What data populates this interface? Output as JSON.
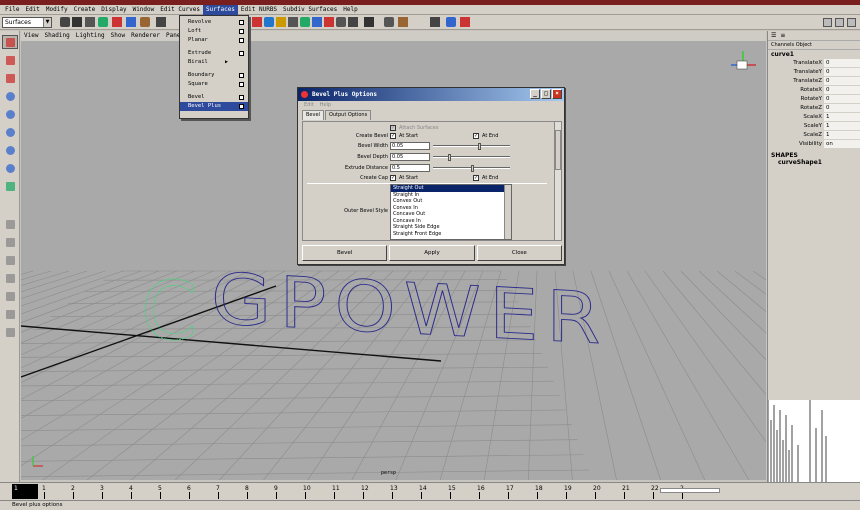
{
  "menubar": {
    "items": [
      "File",
      "Edit",
      "Modify",
      "Create",
      "Display",
      "Window",
      "Edit Curves",
      "Surfaces",
      "Edit NURBS",
      "Subdiv Surfaces",
      "Help"
    ],
    "active_index": 7
  },
  "toolbar": {
    "menuset": "Surfaces"
  },
  "panel_menu": [
    "View",
    "Shading",
    "Lighting",
    "Show",
    "Renderer",
    "Panels"
  ],
  "surfaces_menu": {
    "items": [
      {
        "label": "Revolve",
        "option_box": true
      },
      {
        "label": "Loft",
        "option_box": true
      },
      {
        "label": "Planar",
        "option_box": true
      },
      {
        "label": "Extrude",
        "option_box": true
      },
      {
        "label": "Birail",
        "submenu": true
      },
      {
        "label": "Boundary",
        "option_box": true
      },
      {
        "label": "Square",
        "option_box": true
      },
      {
        "label": "Bevel",
        "option_box": true
      },
      {
        "label": "Bevel Plus",
        "option_box": true,
        "highlighted": true
      }
    ]
  },
  "viewport": {
    "camera_label": "persp",
    "text_3d": "GPOWER",
    "text_3d_ghost": "C"
  },
  "channel_box": {
    "tabs": [
      "Channels",
      "Object"
    ],
    "object": "curve1",
    "attributes": [
      {
        "name": "TranslateX",
        "value": "0"
      },
      {
        "name": "TranslateY",
        "value": "0"
      },
      {
        "name": "TranslateZ",
        "value": "0"
      },
      {
        "name": "RotateX",
        "value": "0"
      },
      {
        "name": "RotateY",
        "value": "0"
      },
      {
        "name": "RotateZ",
        "value": "0"
      },
      {
        "name": "ScaleX",
        "value": "1"
      },
      {
        "name": "ScaleY",
        "value": "1"
      },
      {
        "name": "ScaleZ",
        "value": "1"
      },
      {
        "name": "Visibility",
        "value": "on"
      }
    ],
    "shapes_header": "SHAPES",
    "shape": "curveShape1"
  },
  "dialog": {
    "title": "Bevel Plus Options",
    "menu": [
      "Edit",
      "Help"
    ],
    "tabs": [
      "Bevel",
      "Output Options"
    ],
    "attach_surfaces": "Attach Surfaces",
    "create_bevel_label": "Create Bevel",
    "at_start": "At Start",
    "at_end": "At End",
    "bevel_width_label": "Bevel Width",
    "bevel_width": "0.05",
    "bevel_depth_label": "Bevel Depth",
    "bevel_depth": "0.05",
    "extrude_distance_label": "Extrude Distance",
    "extrude_distance": "0.5",
    "create_cap_label": "Create Cap",
    "outer_bevel_style_label": "Outer Bevel Style",
    "bevel_styles": [
      "Straight Out",
      "Straight In",
      "Convex Out",
      "Convex In",
      "Concave Out",
      "Concave In",
      "Straight Side Edge",
      "Straight Front Edge"
    ],
    "selected_style": 0,
    "buttons": [
      "Bevel",
      "Apply",
      "Close"
    ]
  },
  "timeline": {
    "current": "1",
    "ticks": [
      "1",
      "2",
      "3",
      "4",
      "5",
      "6",
      "7",
      "8",
      "9",
      "10",
      "11",
      "12",
      "13",
      "14",
      "15",
      "16",
      "17",
      "18",
      "19",
      "20",
      "21",
      "22",
      "2"
    ]
  },
  "status": "Bevel plus options"
}
